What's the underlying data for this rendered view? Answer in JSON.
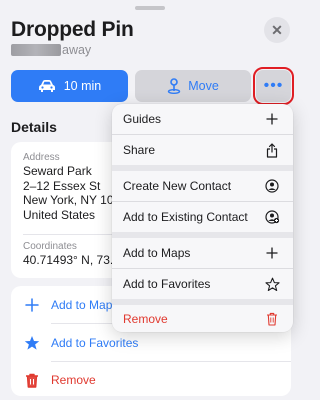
{
  "header": {
    "title": "Dropped Pin",
    "subtitle_suffix": "away",
    "close_icon": "close-icon"
  },
  "actions": {
    "drive_label": "10 min",
    "move_label": "Move",
    "more_label": "•••"
  },
  "details": {
    "header": "Details",
    "address_label": "Address",
    "address_lines": [
      "Seward Park",
      "2–12 Essex St",
      "New York, NY  10",
      "United States"
    ],
    "coordinates_label": "Coordinates",
    "coordinates_value": "40.71493° N, 73."
  },
  "quick_actions": [
    {
      "label": "Add to Map",
      "icon": "plus-icon",
      "color": "#2f7cf6"
    },
    {
      "label": "Add to Favorites",
      "icon": "star-icon",
      "color": "#2f7cf6"
    },
    {
      "label": "Remove",
      "icon": "trash-icon",
      "color": "#e0392f"
    }
  ],
  "menu": {
    "items": [
      {
        "label": "Guides",
        "icon": "plus-icon"
      },
      {
        "label": "Share",
        "icon": "share-icon"
      },
      {
        "label": "Create New Contact",
        "icon": "person-circle-icon"
      },
      {
        "label": "Add to Existing Contact",
        "icon": "person-add-icon"
      },
      {
        "label": "Add to Maps",
        "icon": "plus-icon"
      },
      {
        "label": "Add to Favorites",
        "icon": "star-icon"
      },
      {
        "label": "Remove",
        "icon": "trash-icon",
        "destructive": true
      }
    ]
  },
  "colors": {
    "accent": "#2f7cf6",
    "destructive": "#e0392f",
    "highlight_border": "#e01e24"
  }
}
